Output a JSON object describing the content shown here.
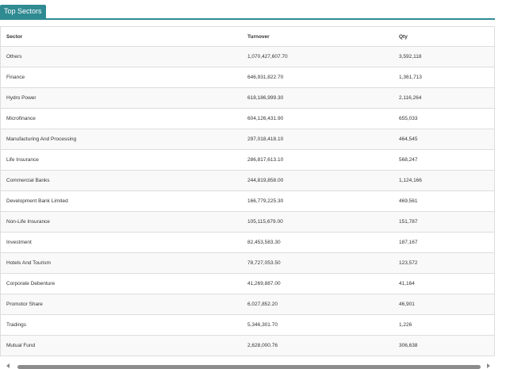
{
  "panel": {
    "tab_label": "Top Sectors"
  },
  "table": {
    "headers": [
      "Sector",
      "Turnover",
      "Qty"
    ],
    "rows": [
      [
        "Others",
        "1,070,427,607.70",
        "3,592,118"
      ],
      [
        "Finance",
        "646,931,822.70",
        "1,361,713"
      ],
      [
        "Hydro Power",
        "618,186,999.30",
        "2,116,264"
      ],
      [
        "Microfinance",
        "604,126,431.90",
        "655,033"
      ],
      [
        "Manufacturing And Processing",
        "297,018,418.10",
        "464,545"
      ],
      [
        "Life Insurance",
        "286,817,613.10",
        "568,247"
      ],
      [
        "Commercial Banks",
        "244,819,858.00",
        "1,124,166"
      ],
      [
        "Development Bank Limited",
        "166,779,225.30",
        "469,561"
      ],
      [
        "Non-Life Insurance",
        "105,115,679.00",
        "151,787"
      ],
      [
        "Investment",
        "82,453,583.30",
        "187,167"
      ],
      [
        "Hotels And Tourism",
        "78,727,053.50",
        "123,572"
      ],
      [
        "Corporate Debenture",
        "41,269,887.00",
        "41,164"
      ],
      [
        "Promotor Share",
        "6,027,852.20",
        "46,901"
      ],
      [
        "Tradings",
        "5,346,301.70",
        "1,226"
      ],
      [
        "Mutual Fund",
        "2,628,000.76",
        "306,638"
      ]
    ]
  },
  "colors": {
    "accent": "#2f8a92",
    "border": "#dddddd",
    "stripe": "#f9f9f9"
  },
  "icons": {
    "scroll_left": "arrow-left-icon",
    "scroll_right": "arrow-right-icon"
  }
}
